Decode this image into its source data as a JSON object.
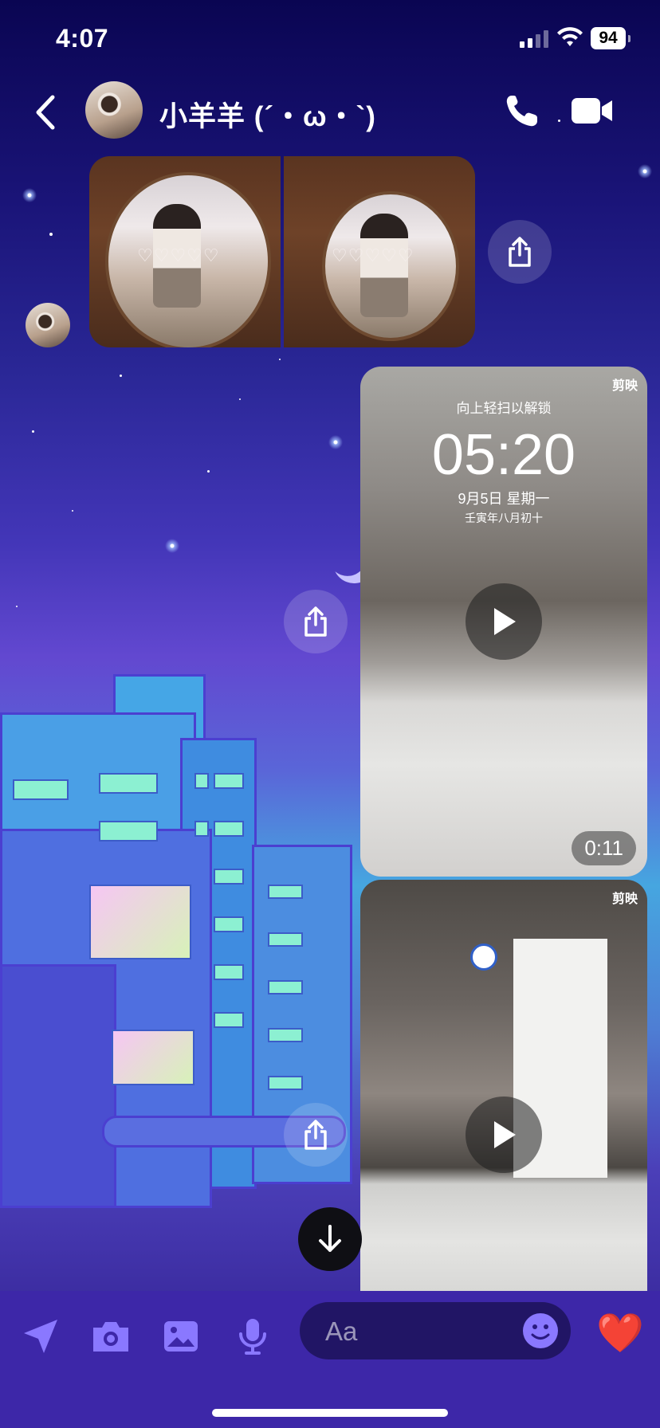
{
  "status_bar": {
    "time": "4:07",
    "battery": "94"
  },
  "header": {
    "contact_name": "小羊羊 (´・ω・`)"
  },
  "messages": {
    "photo_hearts": "♡♡♡♡♡",
    "video1": {
      "watermark": "剪映",
      "lock_hint": "向上轻扫以解锁",
      "clock": "05:20",
      "date": "9月5日  星期一",
      "lunar": "壬寅年八月初十",
      "duration": "0:11"
    },
    "video2": {
      "watermark": "剪映"
    }
  },
  "composer": {
    "placeholder": "Aa",
    "like_emoji": "❤️"
  },
  "colors": {
    "composer_bg": "#3d27a8",
    "accent": "#6a5cff"
  }
}
